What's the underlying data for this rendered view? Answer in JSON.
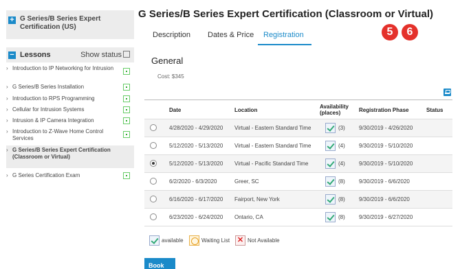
{
  "sidebar": {
    "course_title": "G Series/B Series Expert Certification (US)",
    "expand_glyph": "+",
    "collapse_glyph": "−",
    "lessons_label": "Lessons",
    "show_status_label": "Show status",
    "lessons": [
      {
        "label": "Introduction to IP Networking for Intrusion",
        "status": "in-progress"
      },
      {
        "label": "G Series/B Series Installation",
        "status": "in-progress"
      },
      {
        "label": "Introduction to RPS Programming",
        "status": "in-progress"
      },
      {
        "label": "Cellular for Intrusion Systems",
        "status": "in-progress"
      },
      {
        "label": "Intrusion & IP Camera Integration",
        "status": "in-progress"
      },
      {
        "label": "Introduction to Z-Wave Home Control Services",
        "status": "in-progress"
      },
      {
        "label": "G Series/B Series Expert Certification (Classroom or Virtual)",
        "status": "current"
      },
      {
        "label": "G Series Certification Exam",
        "status": "in-progress"
      }
    ]
  },
  "main": {
    "title": "G Series/B Series Expert Certification (Classroom or Virtual)",
    "tabs": [
      {
        "label": "Description",
        "active": false
      },
      {
        "label": "Dates & Price",
        "active": false
      },
      {
        "label": "Registration",
        "active": true
      }
    ],
    "step_badges": [
      "5",
      "6"
    ],
    "section_title": "General",
    "cost": "Cost: $345",
    "print_icon": "print-icon"
  },
  "table": {
    "headers": {
      "date": "Date",
      "location": "Location",
      "availability": "Availability (places)",
      "phase": "Registration Phase",
      "status": "Status"
    },
    "rows": [
      {
        "date": "4/28/2020 - 4/29/2020",
        "location": "Virtual - Eastern Standard Time",
        "places": "(3)",
        "phase": "9/30/2019 - 4/26/2020",
        "status": "",
        "selected": false
      },
      {
        "date": "5/12/2020 - 5/13/2020",
        "location": "Virtual - Eastern Standard Time",
        "places": "(4)",
        "phase": "9/30/2019 - 5/10/2020",
        "status": "",
        "selected": false
      },
      {
        "date": "5/12/2020 - 5/13/2020",
        "location": "Virtual - Pacific Standard Time",
        "places": "(4)",
        "phase": "9/30/2019 - 5/10/2020",
        "status": "",
        "selected": true
      },
      {
        "date": "6/2/2020 - 6/3/2020",
        "location": "Greer, SC",
        "places": "(8)",
        "phase": "9/30/2019 - 6/6/2020",
        "status": "",
        "selected": false
      },
      {
        "date": "6/16/2020 - 6/17/2020",
        "location": "Fairport, New York",
        "places": "(8)",
        "phase": "9/30/2019 - 6/6/2020",
        "status": "",
        "selected": false
      },
      {
        "date": "6/23/2020 - 6/24/2020",
        "location": "Ontario, CA",
        "places": "(8)",
        "phase": "9/30/2019 - 6/27/2020",
        "status": "",
        "selected": false
      }
    ]
  },
  "legend": {
    "available": "available",
    "waiting": "Waiting List",
    "not_available_glyph": "✕",
    "not_available": "Not Available"
  },
  "book_label": "Book",
  "colors": {
    "accent": "#1a8ac9",
    "badge": "#e4312b"
  }
}
